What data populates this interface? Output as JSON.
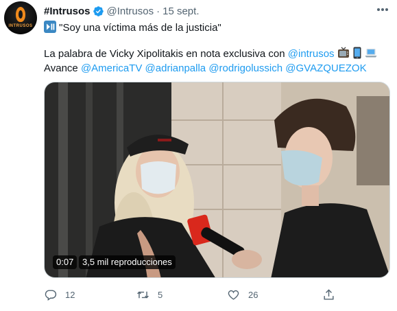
{
  "tweet": {
    "author_name": "#Intrusos",
    "author_handle": "@Intrusos",
    "separator": "·",
    "date": "15 sept.",
    "avatar_logo_text": "INTRUSOS",
    "line1_emoji": "⏯",
    "line1_quote": "\"Soy una víctima más de la justicia\"",
    "line2_text": "La palabra de Vicky Xipolitakis en nota exclusiva con ",
    "line2_mention": "@intrusos",
    "line2_emojis": [
      "tv-emoji",
      "mobile-phone-emoji",
      "laptop-emoji"
    ],
    "line3_prefix": "Avance ",
    "line3_mentions": [
      "@AmericaTV",
      "@adrianpalla",
      "@rodrigolussich",
      "@GVAZQUEZOK"
    ]
  },
  "video": {
    "duration": "0:07",
    "views": "3,5 mil reproducciones"
  },
  "actions": {
    "replies": "12",
    "retweets": "5",
    "likes": "26"
  },
  "colors": {
    "link": "#1d9bf0",
    "verified": "#1d9bf0",
    "muted": "#536471"
  }
}
